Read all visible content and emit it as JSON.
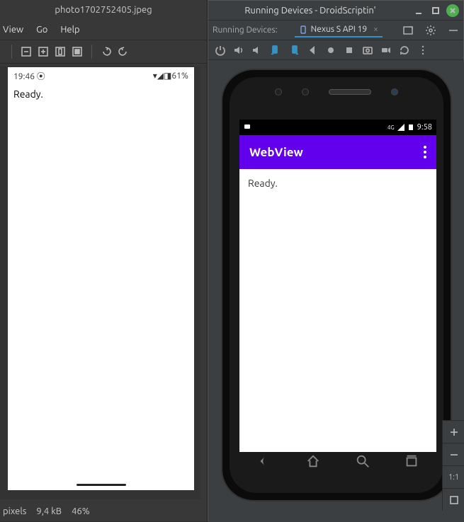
{
  "left": {
    "title": "photo1702752405.jpeg",
    "menubar": {
      "view": "View",
      "go": "Go",
      "help": "Help"
    },
    "photo": {
      "time": "19:46",
      "battery": "61%",
      "content": "Ready."
    },
    "status": {
      "pixels": "pixels",
      "size": "9,4 kB",
      "zoom": "46%"
    }
  },
  "right": {
    "title": "Running Devices - DroidScriptin'",
    "tabbar_label": "Running Devices:",
    "device_tab": "Nexus S API 19",
    "phone": {
      "status_time": "9:58",
      "status_net": "4G",
      "app_title": "WebView",
      "app_content": "Ready."
    },
    "zoom": {
      "one_to_one": "1:1"
    }
  }
}
